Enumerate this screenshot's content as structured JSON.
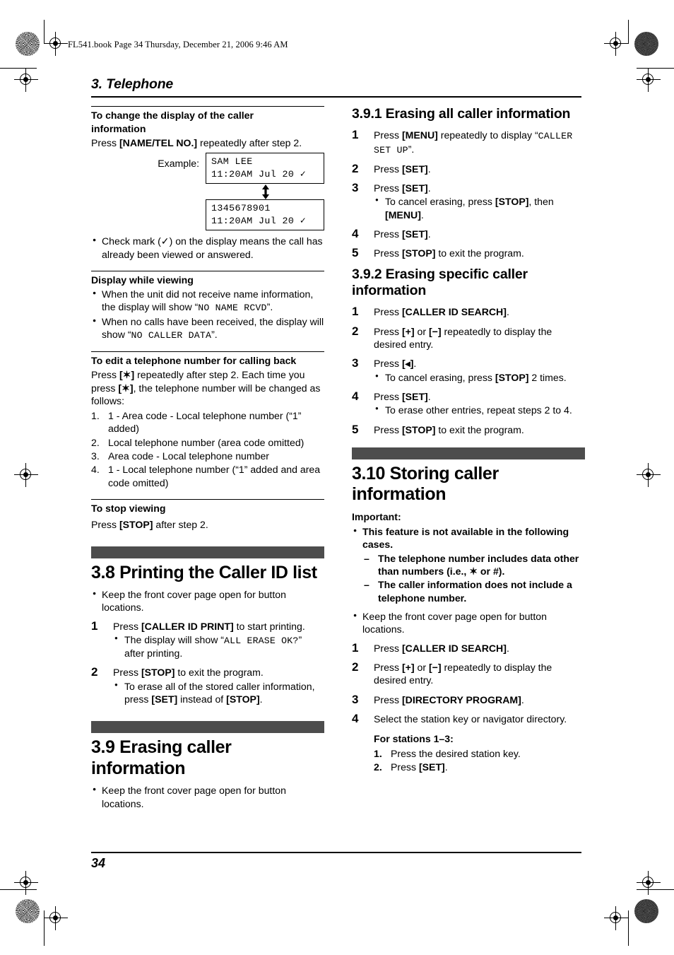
{
  "page": {
    "file_info": "FL541.book  Page 34  Thursday, December 21, 2006  9:46 AM",
    "running_head": "3. Telephone",
    "page_number": "34",
    "bar_color": "#4d4d4d"
  },
  "left_column": {
    "block_display_change": {
      "heading_line1": "To change the display of the caller",
      "heading_line2": "information",
      "press_prefix": "Press ",
      "press_key": "[NAME/TEL NO.]",
      "press_suffix": " repeatedly after step 2.",
      "example_label": "Example:",
      "lcd_top_line1": "SAM LEE",
      "lcd_top_line2": "11:20AM Jul 20 ✓",
      "lcd_bottom_line1": "1345678901",
      "lcd_bottom_line2": "11:20AM Jul 20 ✓",
      "note": "Check mark (✓) on the display means the call has already been viewed or answered."
    },
    "block_display_viewing": {
      "heading": "Display while viewing",
      "note1_a": "When the unit did not receive name information, the display will show “",
      "note1_lcd": "NO NAME RCVD",
      "note1_b": "”.",
      "note2_a": "When no calls have been received, the display will show “",
      "note2_lcd": "NO CALLER DATA",
      "note2_b": "”."
    },
    "block_edit_number": {
      "heading": "To edit a telephone number for calling back",
      "para_a": "Press ",
      "para_key1": "[✶]",
      "para_b": " repeatedly after step 2. Each time you press ",
      "para_key2": "[✶]",
      "para_c": ", the telephone number will be changed as follows:",
      "items": [
        "1 - Area code - Local telephone number (“1” added)",
        "Local telephone number (area code omitted)",
        "Area code - Local telephone number",
        "1 - Local telephone number (“1” added and area code omitted)"
      ]
    },
    "block_stop_viewing": {
      "heading": "To stop viewing",
      "press_prefix": "Press ",
      "press_key": "[STOP]",
      "press_suffix": " after step 2."
    },
    "section_3_8": {
      "title": "3.8 Printing the Caller ID list",
      "note": "Keep the front cover page open for button locations.",
      "steps": [
        {
          "n": "1",
          "text_a": "Press ",
          "key": "[CALLER ID PRINT]",
          "text_b": " to start printing.",
          "bullets": [
            {
              "a": "The display will show “",
              "lcd": "ALL ERASE OK?",
              "b": "” after printing."
            }
          ]
        },
        {
          "n": "2",
          "text_a": "Press ",
          "key": "[STOP]",
          "text_b": " to exit the program.",
          "bullets": [
            {
              "a": "To erase all of the stored caller information, press ",
              "key1": "[SET]",
              "b": " instead of ",
              "key2": "[STOP]",
              "c": "."
            }
          ]
        }
      ]
    },
    "section_3_9": {
      "title": "3.9 Erasing caller information",
      "note": "Keep the front cover page open for button locations."
    }
  },
  "right_column": {
    "section_3_9_1": {
      "title": "3.9.1 Erasing all caller information",
      "steps": [
        {
          "n": "1",
          "text_a": "Press ",
          "key": "[MENU]",
          "text_b": " repeatedly to display “",
          "lcd": "CALLER SET UP",
          "text_c": "”."
        },
        {
          "n": "2",
          "text_a": "Press ",
          "key": "[SET]",
          "text_b": "."
        },
        {
          "n": "3",
          "text_a": "Press ",
          "key": "[SET]",
          "text_b": ".",
          "bullets": [
            {
              "a": "To cancel erasing, press ",
              "key1": "[STOP]",
              "b": ", then ",
              "key2": "[MENU]",
              "c": "."
            }
          ]
        },
        {
          "n": "4",
          "text_a": "Press ",
          "key": "[SET]",
          "text_b": "."
        },
        {
          "n": "5",
          "text_a": "Press ",
          "key": "[STOP]",
          "text_b": " to exit the program."
        }
      ]
    },
    "section_3_9_2": {
      "title": "3.9.2 Erasing specific caller information",
      "steps": [
        {
          "n": "1",
          "text_a": "Press ",
          "key": "[CALLER ID SEARCH]",
          "text_b": "."
        },
        {
          "n": "2",
          "text_a": "Press ",
          "key1": "[+]",
          "text_b": " or ",
          "key2": "[−]",
          "text_c": " repeatedly to display the desired entry."
        },
        {
          "n": "3",
          "text_a": "Press ",
          "key": "[◂]",
          "text_b": ".",
          "bullets": [
            {
              "a": "To cancel erasing, press ",
              "key1": "[STOP]",
              "b": " 2 times."
            }
          ]
        },
        {
          "n": "4",
          "text_a": "Press ",
          "key": "[SET]",
          "text_b": ".",
          "bullets": [
            {
              "a": "To erase other entries, repeat steps 2 to 4."
            }
          ]
        },
        {
          "n": "5",
          "text_a": "Press ",
          "key": "[STOP]",
          "text_b": " to exit the program."
        }
      ]
    },
    "section_3_10": {
      "title": "3.10 Storing caller information",
      "important_label": "Important:",
      "important_bullet": "This feature is not available in the following cases.",
      "important_dashes": [
        "The telephone number includes data other than numbers (i.e., ✶ or #).",
        "The caller information does not include a telephone number."
      ],
      "note": "Keep the front cover page open for button locations.",
      "steps": [
        {
          "n": "1",
          "text_a": "Press ",
          "key": "[CALLER ID SEARCH]",
          "text_b": "."
        },
        {
          "n": "2",
          "text_a": "Press ",
          "key1": "[+]",
          "text_b": " or ",
          "key2": "[−]",
          "text_c": " repeatedly to display the desired entry."
        },
        {
          "n": "3",
          "text_a": "Press ",
          "key": "[DIRECTORY PROGRAM]",
          "text_b": "."
        },
        {
          "n": "4",
          "text_a": "Select the station key or navigator directory."
        }
      ],
      "stations_heading": "For stations 1–3:",
      "stations_items": [
        {
          "a": "Press the desired station key."
        },
        {
          "a": "Press ",
          "key": "[SET]",
          "b": "."
        }
      ]
    }
  }
}
